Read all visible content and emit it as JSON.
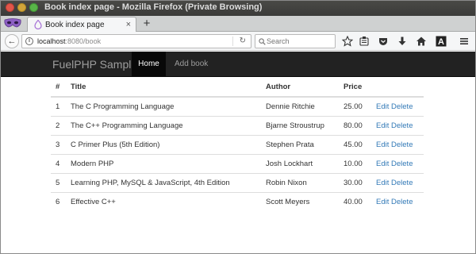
{
  "window": {
    "title": "Book index page - Mozilla Firefox (Private Browsing)"
  },
  "tabs": [
    {
      "label": "Book index page",
      "close": "×"
    }
  ],
  "new_tab_label": "+",
  "toolbar": {
    "url_host": "localhost",
    "url_rest": ":8080/book",
    "search_placeholder": "Search",
    "back_glyph": "←",
    "reload_glyph": "↻",
    "icons": [
      "bookmark-star-icon",
      "reading-list-icon",
      "pocket-icon",
      "download-icon",
      "home-icon",
      "font-icon",
      "menu-icon"
    ]
  },
  "site": {
    "brand": "FuelPHP Sample",
    "nav": [
      {
        "label": "Home",
        "active": true
      },
      {
        "label": "Add book",
        "active": false
      }
    ]
  },
  "table": {
    "headers": [
      "#",
      "Title",
      "Author",
      "Price",
      ""
    ],
    "rows": [
      {
        "num": "1",
        "title": "The C Programming Language",
        "author": "Dennie Ritchie",
        "price": "25.00",
        "edit": "Edit",
        "delete": "Delete"
      },
      {
        "num": "2",
        "title": "The C++ Programming Language",
        "author": "Bjarne Stroustrup",
        "price": "80.00",
        "edit": "Edit",
        "delete": "Delete"
      },
      {
        "num": "3",
        "title": "C Primer Plus (5th Edition)",
        "author": "Stephen Prata",
        "price": "45.00",
        "edit": "Edit",
        "delete": "Delete"
      },
      {
        "num": "4",
        "title": "Modern PHP",
        "author": "Josh Lockhart",
        "price": "10.00",
        "edit": "Edit",
        "delete": "Delete"
      },
      {
        "num": "5",
        "title": "Learning PHP, MySQL & JavaScript, 4th Edition",
        "author": "Robin Nixon",
        "price": "30.00",
        "edit": "Edit",
        "delete": "Delete"
      },
      {
        "num": "6",
        "title": "Effective C++",
        "author": "Scott Meyers",
        "price": "40.00",
        "edit": "Edit",
        "delete": "Delete"
      }
    ]
  },
  "colors": {
    "navbar_bg": "#222222",
    "nav_active_bg": "#080808",
    "link": "#337ab7"
  }
}
